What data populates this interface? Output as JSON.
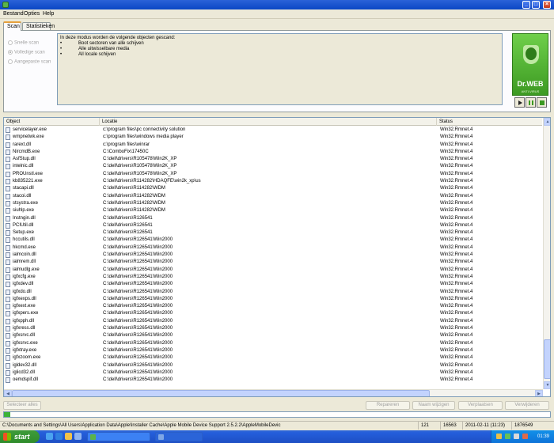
{
  "window": {
    "title": ""
  },
  "menu": [
    "Bestand",
    "Opties",
    "Help"
  ],
  "tabs": [
    "Scan",
    "Statistieken"
  ],
  "scan_modes": [
    {
      "label": "Snelle scan",
      "selected": false
    },
    {
      "label": "Volledige scan",
      "selected": true
    },
    {
      "label": "Aangepaste scan",
      "selected": false
    }
  ],
  "description": {
    "intro": "In deze modus worden de volgende objecten gescand:",
    "bullets": [
      "Boot sectoren van alle schijven",
      "Alle uitwisselbare media",
      "All locale schijven"
    ]
  },
  "brand": {
    "name": "Dr.WEB",
    "tagline": "ANTI-VIRUS"
  },
  "columns": [
    "Object",
    "Locatie",
    "Status"
  ],
  "rows": [
    [
      "servicelayer.exe",
      "c:\\program files\\pc connectivity solution",
      "Win32.Rmnet.4"
    ],
    [
      "wmpnetwk.exe",
      "c:\\program files\\windows media player",
      "Win32.Rmnet.4"
    ],
    [
      "rarext.dll",
      "c:\\program files\\winrar",
      "Win32.Rmnet.4"
    ],
    [
      "NircmdB.exe",
      "C:\\ComboFix\\17450C",
      "Win32.Rmnet.4"
    ],
    [
      "AsfStup.dll",
      "C:\\dell\\drivers\\R105478\\Win2K_XP",
      "Win32.Rmnet.4"
    ],
    [
      "intelnic.dll",
      "C:\\dell\\drivers\\R105478\\Win2K_XP",
      "Win32.Rmnet.4"
    ],
    [
      "PROUnstl.exe",
      "C:\\dell\\drivers\\R105478\\Win2K_XP",
      "Win32.Rmnet.4"
    ],
    [
      "kb835221.exe",
      "C:\\dell\\drivers\\R114282\\HDAQFE\\win2k_xp\\us",
      "Win32.Rmnet.4"
    ],
    [
      "stacapi.dll",
      "C:\\dell\\drivers\\R114282\\WDM",
      "Win32.Rmnet.4"
    ],
    [
      "stacoi.dll",
      "C:\\dell\\drivers\\R114282\\WDM",
      "Win32.Rmnet.4"
    ],
    [
      "stsystra.exe",
      "C:\\dell\\drivers\\R114282\\WDM",
      "Win32.Rmnet.4"
    ],
    [
      "siuhlp.exe",
      "C:\\dell\\drivers\\R114282\\WDM",
      "Win32.Rmnet.4"
    ],
    [
      "Instngin.dll",
      "C:\\dell\\drivers\\R126541",
      "Win32.Rmnet.4"
    ],
    [
      "PCIUtil.dll",
      "C:\\dell\\drivers\\R126541",
      "Win32.Rmnet.4"
    ],
    [
      "Setup.exe",
      "C:\\dell\\drivers\\R126541",
      "Win32.Rmnet.4"
    ],
    [
      "hccutils.dll",
      "C:\\dell\\drivers\\R126541\\Win2000",
      "Win32.Rmnet.4"
    ],
    [
      "hkcmd.exe",
      "C:\\dell\\drivers\\R126541\\Win2000",
      "Win32.Rmnet.4"
    ],
    [
      "ialmcoin.dll",
      "C:\\dell\\drivers\\R126541\\Win2000",
      "Win32.Rmnet.4"
    ],
    [
      "ialmrem.dll",
      "C:\\dell\\drivers\\R126541\\Win2000",
      "Win32.Rmnet.4"
    ],
    [
      "ialmudlg.exe",
      "C:\\dell\\drivers\\R126541\\Win2000",
      "Win32.Rmnet.4"
    ],
    [
      "igfxcfg.exe",
      "C:\\dell\\drivers\\R126541\\Win2000",
      "Win32.Rmnet.4"
    ],
    [
      "igfxdev.dll",
      "C:\\dell\\drivers\\R126541\\Win2000",
      "Win32.Rmnet.4"
    ],
    [
      "igfxdo.dll",
      "C:\\dell\\drivers\\R126541\\Win2000",
      "Win32.Rmnet.4"
    ],
    [
      "igfxexps.dll",
      "C:\\dell\\drivers\\R126541\\Win2000",
      "Win32.Rmnet.4"
    ],
    [
      "igfxext.exe",
      "C:\\dell\\drivers\\R126541\\Win2000",
      "Win32.Rmnet.4"
    ],
    [
      "igfxpers.exe",
      "C:\\dell\\drivers\\R126541\\Win2000",
      "Win32.Rmnet.4"
    ],
    [
      "igfxpph.dll",
      "C:\\dell\\drivers\\R126541\\Win2000",
      "Win32.Rmnet.4"
    ],
    [
      "igfxress.dll",
      "C:\\dell\\drivers\\R126541\\Win2000",
      "Win32.Rmnet.4"
    ],
    [
      "igfxsrvc.dll",
      "C:\\dell\\drivers\\R126541\\Win2000",
      "Win32.Rmnet.4"
    ],
    [
      "igfxsrvc.exe",
      "C:\\dell\\drivers\\R126541\\Win2000",
      "Win32.Rmnet.4"
    ],
    [
      "igfxtray.exe",
      "C:\\dell\\drivers\\R126541\\Win2000",
      "Win32.Rmnet.4"
    ],
    [
      "igfxzoom.exe",
      "C:\\dell\\drivers\\R126541\\Win2000",
      "Win32.Rmnet.4"
    ],
    [
      "igldev32.dll",
      "C:\\dell\\drivers\\R126541\\Win2000",
      "Win32.Rmnet.4"
    ],
    [
      "iglicd32.dll",
      "C:\\dell\\drivers\\R126541\\Win2000",
      "Win32.Rmnet.4"
    ],
    [
      "oemdspif.dll",
      "C:\\dell\\drivers\\R126541\\Win2000",
      "Win32.Rmnet.4"
    ]
  ],
  "buttons": {
    "select_all": "Selecteer alles",
    "repair": "Repareren",
    "rename": "Naam wijzigen",
    "move": "Verplaatsen",
    "delete": "Verwijderen"
  },
  "progress": 0.012,
  "status": {
    "path": "C:\\Documents and Settings\\All Users\\Application Data\\Apple\\Installer Cache\\Apple Mobile Device Support 2.5.2.2\\AppleMobileDevic",
    "infected": "121",
    "checked": "16563",
    "datetime": "2011-02-11 (11:23)",
    "files": "1876549"
  },
  "taskbar": {
    "start": "start",
    "clock": "01:39"
  },
  "colors": {
    "accent": "#0a46c4",
    "brand_green": "#3c9a22",
    "progress": "#3cb337"
  }
}
